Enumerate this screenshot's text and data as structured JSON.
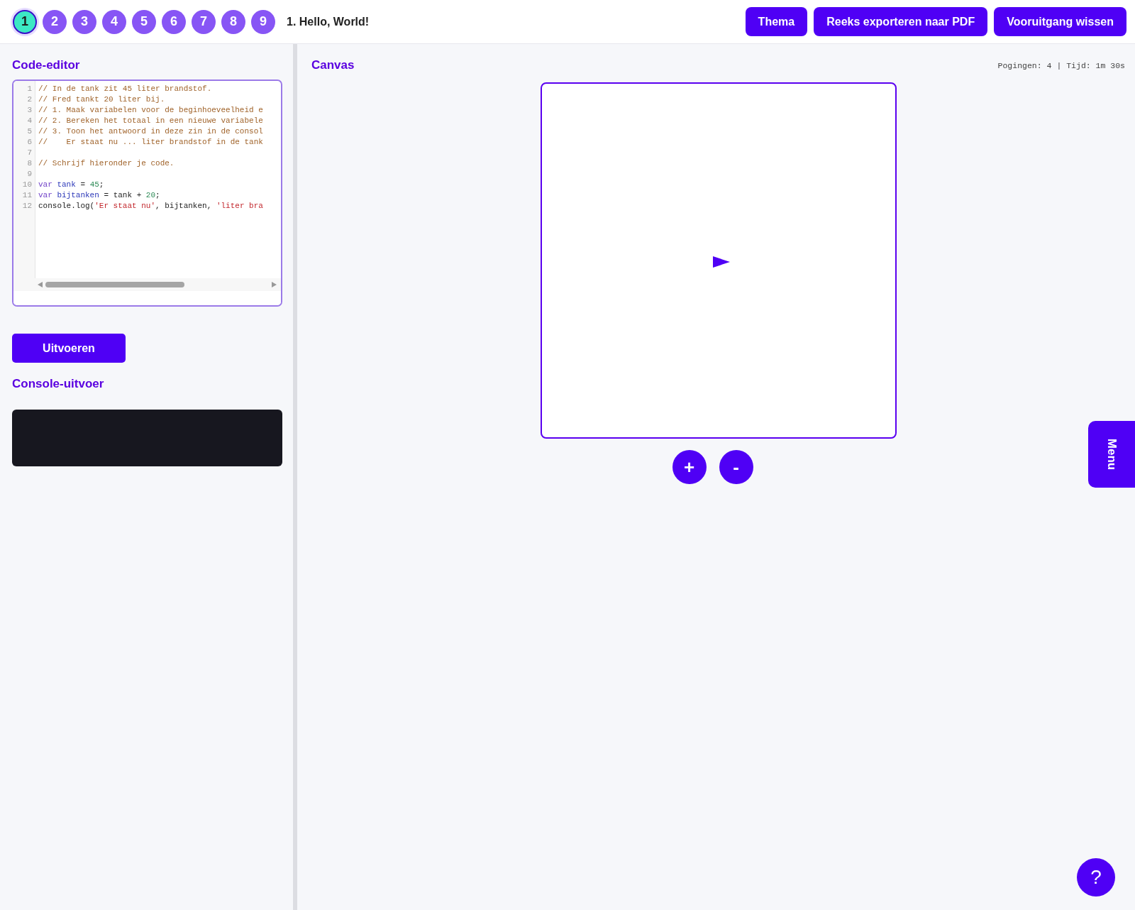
{
  "steps": [
    {
      "label": "1",
      "selected": true
    },
    {
      "label": "2",
      "selected": false
    },
    {
      "label": "3",
      "selected": false
    },
    {
      "label": "4",
      "selected": false
    },
    {
      "label": "5",
      "selected": false
    },
    {
      "label": "6",
      "selected": false
    },
    {
      "label": "7",
      "selected": false
    },
    {
      "label": "8",
      "selected": false
    },
    {
      "label": "9",
      "selected": false
    }
  ],
  "lesson_title": "1. Hello, World!",
  "header_buttons": [
    "Thema",
    "Reeks exporteren naar PDF",
    "Vooruitgang wissen"
  ],
  "editor": {
    "title": "Code-editor",
    "lines": [
      {
        "number": "1",
        "tokens": [
          {
            "kind": "comment",
            "text": "// In de tank zit 45 liter brandstof."
          }
        ]
      },
      {
        "number": "2",
        "tokens": [
          {
            "kind": "comment",
            "text": "// Fred tankt 20 liter bij."
          }
        ]
      },
      {
        "number": "3",
        "tokens": [
          {
            "kind": "comment",
            "text": "// 1. Maak variabelen voor de beginhoeveelheid e"
          }
        ]
      },
      {
        "number": "4",
        "tokens": [
          {
            "kind": "comment",
            "text": "// 2. Bereken het totaal in een nieuwe variabele"
          }
        ]
      },
      {
        "number": "5",
        "tokens": [
          {
            "kind": "comment",
            "text": "// 3. Toon het antwoord in deze zin in de consol"
          }
        ]
      },
      {
        "number": "6",
        "tokens": [
          {
            "kind": "comment",
            "text": "//    Er staat nu ... liter brandstof in de tank"
          }
        ]
      },
      {
        "number": "7"
      },
      {
        "number": "8",
        "tokens": [
          {
            "kind": "comment",
            "text": "// Schrijf hieronder je code."
          }
        ]
      },
      {
        "number": "9"
      },
      {
        "number": "10",
        "tokens": [
          {
            "kind": "keyword",
            "text": "var "
          },
          {
            "kind": "variable",
            "text": "tank"
          },
          {
            "kind": "plain",
            "text": " = "
          },
          {
            "kind": "number",
            "text": "45"
          },
          {
            "kind": "plain",
            "text": ";"
          }
        ]
      },
      {
        "number": "11",
        "tokens": [
          {
            "kind": "keyword",
            "text": "var "
          },
          {
            "kind": "variable",
            "text": "bijtanken"
          },
          {
            "kind": "plain",
            "text": " = tank + "
          },
          {
            "kind": "number",
            "text": "20"
          },
          {
            "kind": "plain",
            "text": ";"
          }
        ]
      },
      {
        "number": "12",
        "tokens": [
          {
            "kind": "plain",
            "text": "console.log("
          },
          {
            "kind": "string",
            "text": "'Er staat nu'"
          },
          {
            "kind": "plain",
            "text": ", bijtanken, "
          },
          {
            "kind": "string",
            "text": "'liter bra"
          }
        ]
      }
    ]
  },
  "run_button": "Uitvoeren",
  "console": {
    "title": "Console-uitvoer"
  },
  "canvas": {
    "title": "Canvas",
    "stats": "Pogingen: 4 | Tijd: 1m 30s",
    "zoom_buttons": [
      "+",
      "-"
    ]
  },
  "menu_tab": "Menu",
  "help_button": "?"
}
